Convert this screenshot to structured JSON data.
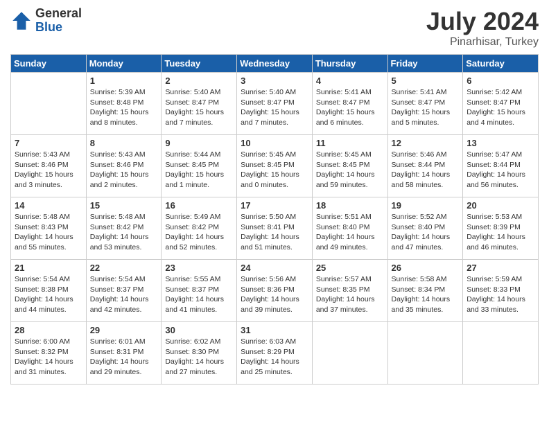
{
  "header": {
    "logo_general": "General",
    "logo_blue": "Blue",
    "month_year": "July 2024",
    "location": "Pinarhisar, Turkey"
  },
  "days_of_week": [
    "Sunday",
    "Monday",
    "Tuesday",
    "Wednesday",
    "Thursday",
    "Friday",
    "Saturday"
  ],
  "weeks": [
    [
      {
        "day": "",
        "info": ""
      },
      {
        "day": "1",
        "info": "Sunrise: 5:39 AM\nSunset: 8:48 PM\nDaylight: 15 hours\nand 8 minutes."
      },
      {
        "day": "2",
        "info": "Sunrise: 5:40 AM\nSunset: 8:47 PM\nDaylight: 15 hours\nand 7 minutes."
      },
      {
        "day": "3",
        "info": "Sunrise: 5:40 AM\nSunset: 8:47 PM\nDaylight: 15 hours\nand 7 minutes."
      },
      {
        "day": "4",
        "info": "Sunrise: 5:41 AM\nSunset: 8:47 PM\nDaylight: 15 hours\nand 6 minutes."
      },
      {
        "day": "5",
        "info": "Sunrise: 5:41 AM\nSunset: 8:47 PM\nDaylight: 15 hours\nand 5 minutes."
      },
      {
        "day": "6",
        "info": "Sunrise: 5:42 AM\nSunset: 8:47 PM\nDaylight: 15 hours\nand 4 minutes."
      }
    ],
    [
      {
        "day": "7",
        "info": "Sunrise: 5:43 AM\nSunset: 8:46 PM\nDaylight: 15 hours\nand 3 minutes."
      },
      {
        "day": "8",
        "info": "Sunrise: 5:43 AM\nSunset: 8:46 PM\nDaylight: 15 hours\nand 2 minutes."
      },
      {
        "day": "9",
        "info": "Sunrise: 5:44 AM\nSunset: 8:45 PM\nDaylight: 15 hours\nand 1 minute."
      },
      {
        "day": "10",
        "info": "Sunrise: 5:45 AM\nSunset: 8:45 PM\nDaylight: 15 hours\nand 0 minutes."
      },
      {
        "day": "11",
        "info": "Sunrise: 5:45 AM\nSunset: 8:45 PM\nDaylight: 14 hours\nand 59 minutes."
      },
      {
        "day": "12",
        "info": "Sunrise: 5:46 AM\nSunset: 8:44 PM\nDaylight: 14 hours\nand 58 minutes."
      },
      {
        "day": "13",
        "info": "Sunrise: 5:47 AM\nSunset: 8:44 PM\nDaylight: 14 hours\nand 56 minutes."
      }
    ],
    [
      {
        "day": "14",
        "info": "Sunrise: 5:48 AM\nSunset: 8:43 PM\nDaylight: 14 hours\nand 55 minutes."
      },
      {
        "day": "15",
        "info": "Sunrise: 5:48 AM\nSunset: 8:42 PM\nDaylight: 14 hours\nand 53 minutes."
      },
      {
        "day": "16",
        "info": "Sunrise: 5:49 AM\nSunset: 8:42 PM\nDaylight: 14 hours\nand 52 minutes."
      },
      {
        "day": "17",
        "info": "Sunrise: 5:50 AM\nSunset: 8:41 PM\nDaylight: 14 hours\nand 51 minutes."
      },
      {
        "day": "18",
        "info": "Sunrise: 5:51 AM\nSunset: 8:40 PM\nDaylight: 14 hours\nand 49 minutes."
      },
      {
        "day": "19",
        "info": "Sunrise: 5:52 AM\nSunset: 8:40 PM\nDaylight: 14 hours\nand 47 minutes."
      },
      {
        "day": "20",
        "info": "Sunrise: 5:53 AM\nSunset: 8:39 PM\nDaylight: 14 hours\nand 46 minutes."
      }
    ],
    [
      {
        "day": "21",
        "info": "Sunrise: 5:54 AM\nSunset: 8:38 PM\nDaylight: 14 hours\nand 44 minutes."
      },
      {
        "day": "22",
        "info": "Sunrise: 5:54 AM\nSunset: 8:37 PM\nDaylight: 14 hours\nand 42 minutes."
      },
      {
        "day": "23",
        "info": "Sunrise: 5:55 AM\nSunset: 8:37 PM\nDaylight: 14 hours\nand 41 minutes."
      },
      {
        "day": "24",
        "info": "Sunrise: 5:56 AM\nSunset: 8:36 PM\nDaylight: 14 hours\nand 39 minutes."
      },
      {
        "day": "25",
        "info": "Sunrise: 5:57 AM\nSunset: 8:35 PM\nDaylight: 14 hours\nand 37 minutes."
      },
      {
        "day": "26",
        "info": "Sunrise: 5:58 AM\nSunset: 8:34 PM\nDaylight: 14 hours\nand 35 minutes."
      },
      {
        "day": "27",
        "info": "Sunrise: 5:59 AM\nSunset: 8:33 PM\nDaylight: 14 hours\nand 33 minutes."
      }
    ],
    [
      {
        "day": "28",
        "info": "Sunrise: 6:00 AM\nSunset: 8:32 PM\nDaylight: 14 hours\nand 31 minutes."
      },
      {
        "day": "29",
        "info": "Sunrise: 6:01 AM\nSunset: 8:31 PM\nDaylight: 14 hours\nand 29 minutes."
      },
      {
        "day": "30",
        "info": "Sunrise: 6:02 AM\nSunset: 8:30 PM\nDaylight: 14 hours\nand 27 minutes."
      },
      {
        "day": "31",
        "info": "Sunrise: 6:03 AM\nSunset: 8:29 PM\nDaylight: 14 hours\nand 25 minutes."
      },
      {
        "day": "",
        "info": ""
      },
      {
        "day": "",
        "info": ""
      },
      {
        "day": "",
        "info": ""
      }
    ]
  ]
}
